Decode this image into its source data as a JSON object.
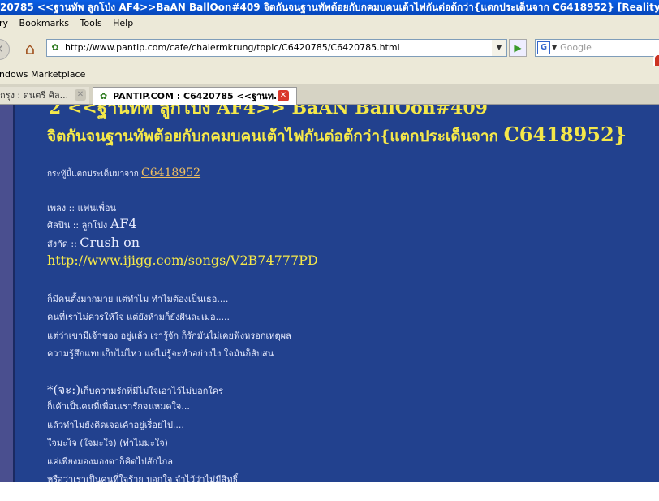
{
  "window": {
    "title": "20785 <<ฐานทัพ ลูกโป่ง AF4>>BaAN BallOon#409 จิตกันจนฐานทัพต้อยกับกคมบคนเต้าไฟกันต่อต้กว่า{แตกประเด็นจาก C6418952} [Reality Sh..."
  },
  "menubar": {
    "items": [
      "ry",
      "Bookmarks",
      "Tools",
      "Help"
    ]
  },
  "toolbar": {
    "url": "http://www.pantip.com/cafe/chalermkrung/topic/C6420785/C6420785.html",
    "search_placeholder": "Google",
    "search_engine_letter": "G"
  },
  "bookmarks": {
    "item": "indows Marketplace"
  },
  "tabs": [
    {
      "label": "กรุง : ดนตรี ศิล...",
      "active": false
    },
    {
      "label": "PANTIP.COM : C6420785 <<ฐานท...",
      "active": true
    }
  ],
  "post": {
    "cut_title": "2 <<ฐานทัพ ลูกโป่ง AF4>> BaAN BallOon#409",
    "title_thai": "จิตกันจนฐานทัพต้อยกับกคมบคนเต้าไฟกันต่อต้กว่า{แตกประเด็นจาก ",
    "title_code": "C6418952}",
    "source_label": "กระทู้นี้แตกประเด็นมาจาก ",
    "source_link": "C6418952",
    "song_label": "เพลง  :: แฟนเพื่อน",
    "artist_label": "ศิลปิน :: ลูกโป่ง ",
    "artist_name": "AF4",
    "album_label": "สังกัด :: ",
    "album_name": "Crush on",
    "song_url": "http://www.ijigg.com/songs/V2B74777PD",
    "lyrics_a": [
      "ก็มีคนตั้งมากมาย แต่ทำไม ทำไมต้องเป็นเธอ....",
      "คนที่เราไม่ควรให้ใจ แต่ยังห้ามก็ยังฝันละเมอ.....",
      "แต่ว่าเขามีเจ้าของ อยู่แล้ว เรารู้จัก ก็รักมันไม่เคยฟังหรอกเหตุผล",
      "ความรู้สึกแทบเก็บไม่ไหว แต่ไม่รู้จะทำอย่างไง ใจมันก็สับสน"
    ],
    "chorus_mark": "*(จะ:)",
    "lyrics_b": [
      "เก็บความรักที่มีไม่ใจเอาไว้ไม่บอกใคร",
      "ก็เค้าเป็นคนที่เพื่อนเรารักจนหมดใจ...",
      "แล้วทำไมยังคิดเจอเค้าอยู่เรื่อยไป....",
      "ใจมะใจ (ใจมะใจ) (ทำไมมะใจ)",
      "แค่เพียงมองมองตาก็คิดไปสักไกล",
      "หรือว่าเราเป็นคนที่ใจร้าย บอกใจ จำไว้ว่าไม่มีสิทธิ์"
    ]
  },
  "colors": {
    "page_bg": "#22418e",
    "text_yellow": "#f5e84a",
    "text_white": "#e8ecff",
    "titlebar": "#0a5fe6",
    "chrome": "#ece9d8"
  }
}
